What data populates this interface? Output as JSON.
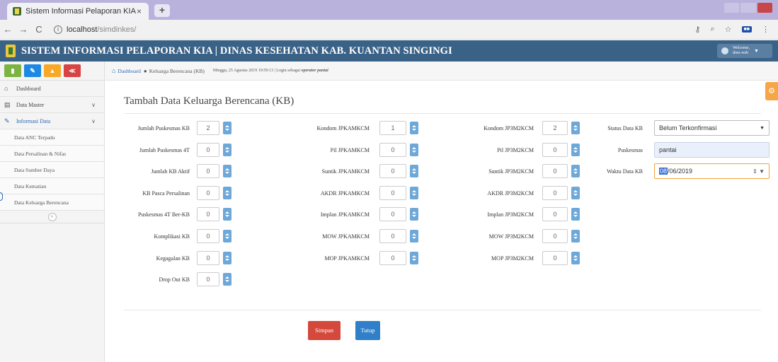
{
  "browser": {
    "tab_title": "Sistem Informasi Pelaporan KIA",
    "tab_close": "×",
    "new_tab": "+",
    "url_host": "localhost",
    "url_path": "/simdinkes/"
  },
  "header": {
    "title": "SISTEM INFORMASI PELAPORAN KIA | DINAS KESEHATAN KAB. KUANTAN SINGINGI",
    "user_line1": "Welcome,",
    "user_line2": "dora web"
  },
  "sidebar": {
    "items": [
      {
        "label": "Dashboard"
      },
      {
        "label": "Data Master"
      },
      {
        "label": "Informasi Data"
      }
    ],
    "subitems": [
      {
        "label": "Data ANC Terpadu"
      },
      {
        "label": "Data Persalinan & Nifas"
      },
      {
        "label": "Data Sumber Daya"
      },
      {
        "label": "Data Kematian"
      },
      {
        "label": "Data Keluarga Berencana"
      }
    ]
  },
  "breadcrumb": {
    "home": "Dashboard",
    "current": "Keluarga Berencana (KB)",
    "meta_prefix": "Minggu, 25 Agustus 2019 19:59:13 | Login sebagai ",
    "meta_user": "operator pantai"
  },
  "form": {
    "title": "Tambah Data Keluarga Berencana (KB)",
    "col1": [
      {
        "label": "Jumlah Puskesmas KB",
        "value": "2"
      },
      {
        "label": "Jumlah Puskesmas 4T",
        "value": "0"
      },
      {
        "label": "Jumlah KB Aktif",
        "value": "0"
      },
      {
        "label": "KB Pasca Persalinan",
        "value": "0"
      },
      {
        "label": "Puskesmas 4T Ber-KB",
        "value": "0"
      },
      {
        "label": "Komplikasi KB",
        "value": "0"
      },
      {
        "label": "Kegagalan KB",
        "value": "0"
      },
      {
        "label": "Drop Out KB",
        "value": "0"
      }
    ],
    "col2": [
      {
        "label": "Kondom JPKAMKCM",
        "value": "1"
      },
      {
        "label": "Pil JPKAMKCM",
        "value": "0"
      },
      {
        "label": "Suntik JPKAMKCM",
        "value": "0"
      },
      {
        "label": "AKDR JPKAMKCM",
        "value": "0"
      },
      {
        "label": "Implan JPKAMKCM",
        "value": "0"
      },
      {
        "label": "MOW JPKAMKCM",
        "value": "0"
      },
      {
        "label": "MOP JPKAMKCM",
        "value": "0"
      }
    ],
    "col3": [
      {
        "label": "Kondom JP3M2KCM",
        "value": "2"
      },
      {
        "label": "Pil JP3M2KCM",
        "value": "0"
      },
      {
        "label": "Suntik JP3M2KCM",
        "value": "0"
      },
      {
        "label": "AKDR JP3M2KCM",
        "value": "0"
      },
      {
        "label": "Implan JP3M2KCM",
        "value": "0"
      },
      {
        "label": "MOW JP3M2KCM",
        "value": "0"
      },
      {
        "label": "MOP JP3M2KCM",
        "value": "0"
      }
    ],
    "status_label": "Status Data KB",
    "status_value": "Belum Terkonfirmasi",
    "puskesmas_label": "Puskesmas",
    "puskesmas_value": "pantai",
    "waktu_label": "Waktu Data KB",
    "waktu_day": "08",
    "waktu_rest": "/06/2019",
    "save_label": "Simpan",
    "close_label": "Tutup"
  },
  "colors": {
    "header_bg": "#3a6287",
    "save_button": "#d4493c",
    "close_button": "#2f7fc9",
    "spinner": "#6ea8d8"
  }
}
